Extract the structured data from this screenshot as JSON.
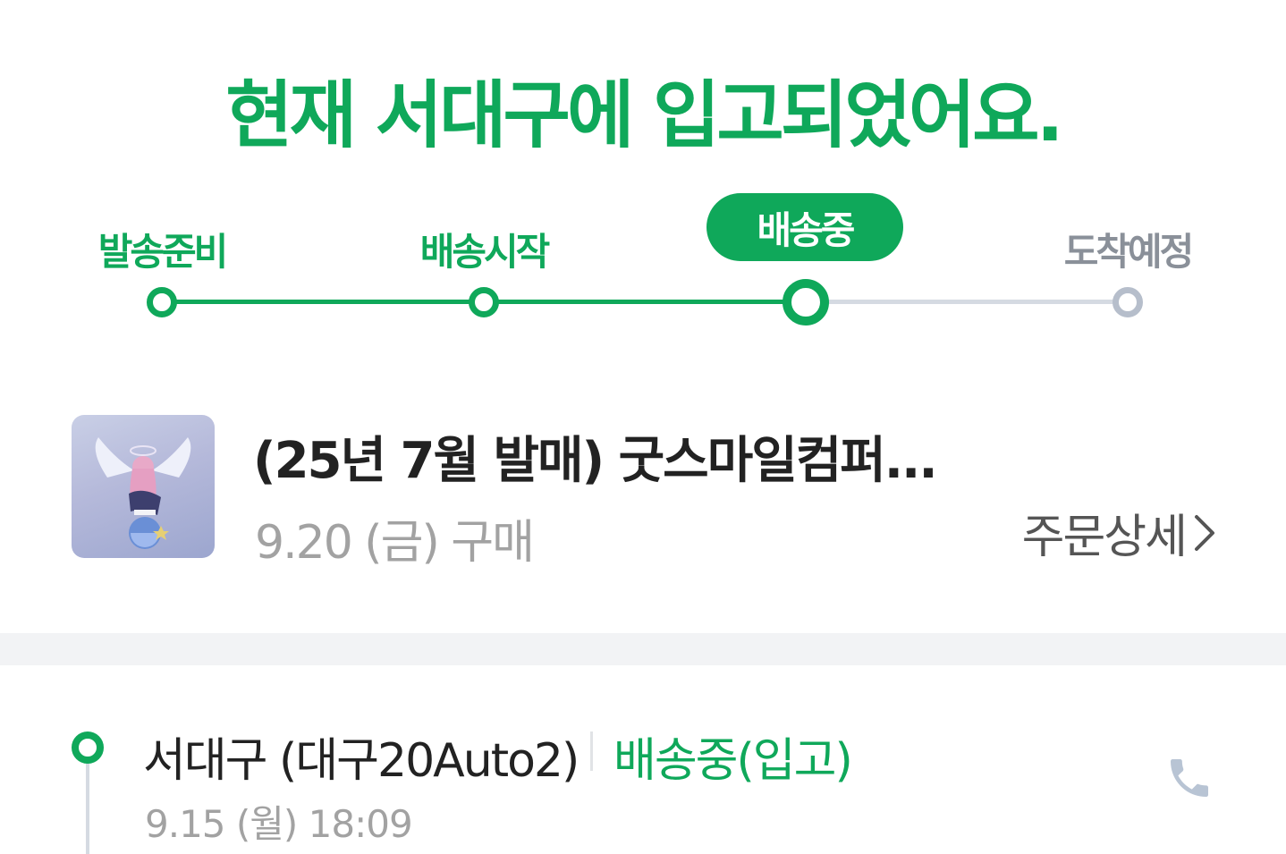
{
  "headline": "현재 서대구에 입고되었어요.",
  "steps": [
    {
      "label": "발송준비",
      "state": "done"
    },
    {
      "label": "배송시작",
      "state": "done"
    },
    {
      "label": "배송중",
      "state": "current"
    },
    {
      "label": "도착예정",
      "state": "pending"
    }
  ],
  "colors": {
    "accent": "#0fa85a",
    "pending": "#b6becb",
    "text_muted": "#a2a2a2"
  },
  "product": {
    "title": "(25년 7월 발매) 굿스마일컴퍼...",
    "purchase_date": "9.20 (금) 구매",
    "order_detail_label": "주문상세",
    "thumbnail_icon": "figure-image"
  },
  "tracking": {
    "location": "서대구 (대구20Auto2)",
    "status": "배송중(입고)",
    "timestamp": "9.15 (월) 18:09",
    "call_icon": "phone-icon"
  }
}
